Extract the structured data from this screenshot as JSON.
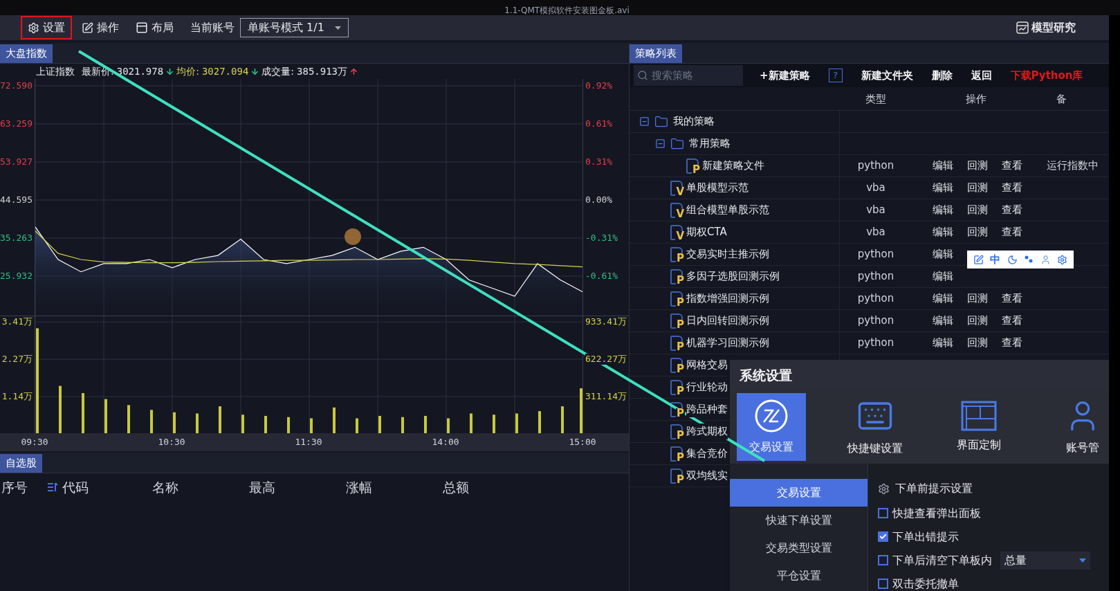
{
  "video_title": "1.1-QMT模拟软件安装图金板.avi",
  "toolbar": {
    "items": [
      {
        "kind": "gear",
        "label": "设置",
        "highlighted": true
      },
      {
        "kind": "edit",
        "label": "操作",
        "highlighted": false
      },
      {
        "kind": "layout",
        "label": "布局",
        "highlighted": false
      }
    ],
    "account_label": "当前账号",
    "account_mode": "单账号模式 1/1",
    "research_button": "模型研究"
  },
  "market_panel": {
    "tab": {
      "label": "大盘指数",
      "selected": true
    },
    "index_name": "上证指数",
    "stats": [
      {
        "kind": "price",
        "label": "最新价:",
        "value": "3021.978",
        "rising": false
      },
      {
        "kind": "average",
        "label": "均价:",
        "value": "3027.094",
        "rising": false
      },
      {
        "kind": "volume",
        "label": "成交量:",
        "value": "385.913万",
        "rising": true
      }
    ],
    "price_chart": {
      "pct_labels": [
        {
          "label": "0.92%",
          "color": "#e0404a"
        },
        {
          "label": "0.61%",
          "color": "#e0404a"
        },
        {
          "label": "0.31%",
          "color": "#e0404a"
        },
        {
          "label": "0.00%",
          "color": "#d0d0d0"
        },
        {
          "label": "-0.31%",
          "color": "#2fbf86"
        },
        {
          "label": "-0.61%",
          "color": "#2fbf86"
        }
      ],
      "chart_data": {
        "type": "line",
        "grid": true,
        "ylim": [
          16.26,
          74.29
        ],
        "categories": [
          null,
          null,
          null,
          null,
          null,
          null,
          null,
          null,
          null,
          null,
          null,
          null,
          null,
          null,
          null,
          null,
          null,
          null,
          null,
          null,
          null,
          null,
          null,
          null,
          null
        ],
        "yticks": [
          {
            "value": 72.59,
            "label": "72.590"
          },
          {
            "value": 63.259,
            "label": "63.259"
          },
          {
            "value": 53.927,
            "label": "53.927"
          },
          {
            "value": 44.595,
            "label": "44.595"
          },
          {
            "value": 35.263,
            "label": "35.263"
          },
          {
            "value": 25.932,
            "label": "25.932"
          }
        ],
        "series": [
          {
            "color": "#ffffff",
            "values": [
              38,
              30,
              27,
              29,
              29,
              30,
              28,
              30,
              31,
              35,
              30,
              29,
              30,
              31,
              33,
              30,
              32,
              33,
              30,
              25,
              23,
              21,
              29,
              25,
              22
            ]
          },
          {
            "color": "#d8d24a",
            "values": [
              37,
              31.5,
              30,
              29.4,
              29.3,
              29.2,
              29.2,
              29.3,
              29.5,
              29.6,
              29.7,
              29.8,
              29.8,
              29.9,
              30,
              30,
              30.1,
              30.2,
              30.1,
              29.8,
              29.4,
              29,
              28.8,
              28.5,
              28.2
            ]
          }
        ]
      }
    },
    "volume_chart": {
      "left_labels": [
        "3.41万",
        "2.27万",
        "1.14万"
      ],
      "chart_data": {
        "type": "bar",
        "grid": true,
        "ylim": [
          0,
          980
        ],
        "categories": [
          "09:30",
          null,
          null,
          null,
          null,
          null,
          "10:30",
          null,
          null,
          null,
          null,
          null,
          "11:30",
          null,
          null,
          null,
          null,
          null,
          "14:00",
          null,
          null,
          null,
          null,
          null,
          "15:00"
        ],
        "yticks": [
          {
            "value": 933.41,
            "label": "933.41万"
          },
          {
            "value": 622.27,
            "label": "622.27万"
          },
          {
            "value": 311.14,
            "label": "311.14万"
          }
        ],
        "series": [
          {
            "color": "#c9c93a",
            "values": [
              880,
              400,
              340,
              290,
              240,
              200,
              180,
              170,
              230,
              160,
              150,
              140,
              130,
              220,
              130,
              150,
              140,
              150,
              130,
              170,
              160,
              170,
              190,
              230,
              380
            ]
          }
        ]
      }
    }
  },
  "watchlist": {
    "tab": {
      "label": "自选股",
      "selected": true
    },
    "columns": [
      {
        "label": "序号",
        "sorted": false
      },
      {
        "label": "代码",
        "sorted": true
      },
      {
        "label": "名称",
        "sorted": false
      },
      {
        "label": "最高",
        "sorted": false
      },
      {
        "label": "涨幅",
        "sorted": false
      },
      {
        "label": "总额",
        "sorted": false
      }
    ]
  },
  "strategy_panel": {
    "tab": {
      "label": "策略列表",
      "selected": true
    },
    "search": {
      "placeholder": "搜索策略"
    },
    "actions": [
      {
        "kind": "text",
        "label": "+新建策略"
      },
      {
        "kind": "help",
        "label": "?"
      },
      {
        "kind": "text",
        "label": "新建文件夹"
      },
      {
        "kind": "text",
        "label": "删除"
      },
      {
        "kind": "text",
        "label": "返回"
      },
      {
        "kind": "link",
        "label": "下载Python库"
      }
    ],
    "columns": [
      "类型",
      "操作",
      "备"
    ],
    "tree": [
      {
        "kind": "folder",
        "name": "我的策略",
        "expanded": true,
        "children": [
          {
            "kind": "folder",
            "name": "常用策略",
            "expanded": true,
            "children": [
              {
                "kind": "file",
                "badge": "P",
                "name": "新建策略文件",
                "type": "python",
                "actions": [
                  "编辑",
                  "回测",
                  "查看"
                ],
                "note": "运行指数中"
              }
            ]
          },
          {
            "kind": "file",
            "badge": "V",
            "name": "单股模型示范",
            "type": "vba",
            "actions": [
              "编辑",
              "回测",
              "查看"
            ]
          },
          {
            "kind": "file",
            "badge": "V",
            "name": "组合模型单股示范",
            "type": "vba",
            "actions": [
              "编辑",
              "回测",
              "查看"
            ]
          },
          {
            "kind": "file",
            "badge": "V",
            "name": "期权CTA",
            "type": "vba",
            "actions": [
              "编辑",
              "回测",
              "查看"
            ]
          },
          {
            "kind": "file",
            "badge": "P",
            "name": "交易实时主推示例",
            "type": "python",
            "actions": [
              "编辑"
            ]
          },
          {
            "kind": "file",
            "badge": "P",
            "name": "多因子选股回测示例",
            "type": "python",
            "actions": [
              "编辑"
            ]
          },
          {
            "kind": "file",
            "badge": "P",
            "name": "指数增强回测示例",
            "type": "python",
            "actions": [
              "编辑",
              "回测",
              "查看"
            ]
          },
          {
            "kind": "file",
            "badge": "P",
            "name": "日内回转回测示例",
            "type": "python",
            "actions": [
              "编辑",
              "回测",
              "查看"
            ]
          },
          {
            "kind": "file",
            "badge": "P",
            "name": "机器学习回测示例",
            "type": "python",
            "actions": [
              "编辑",
              "回测",
              "查看"
            ]
          },
          {
            "kind": "file",
            "badge": "P",
            "name": "网格交易"
          },
          {
            "kind": "file",
            "badge": "P",
            "name": "行业轮动"
          },
          {
            "kind": "file",
            "badge": "P",
            "name": "跨品种套"
          },
          {
            "kind": "file",
            "badge": "P",
            "name": "跨式期权"
          },
          {
            "kind": "file",
            "badge": "P",
            "name": "集合竞价"
          },
          {
            "kind": "file",
            "badge": "P",
            "name": "双均线实"
          }
        ]
      }
    ]
  },
  "ime_toolbar": {
    "mode": "中"
  },
  "settings_dialog": {
    "title": "系统设置",
    "categories": [
      {
        "kind": "trade",
        "label": "交易设置",
        "selected": true
      },
      {
        "kind": "keyboard",
        "label": "快捷键设置",
        "selected": false
      },
      {
        "kind": "layout",
        "label": "界面定制",
        "selected": false
      },
      {
        "kind": "user",
        "label": "账号管",
        "selected": false
      }
    ],
    "menu": [
      {
        "label": "交易设置",
        "selected": true
      },
      {
        "label": "快速下单设置",
        "selected": false
      },
      {
        "label": "交易类型设置",
        "selected": false
      },
      {
        "label": "平仓设置",
        "selected": false
      }
    ],
    "section_title": "下单前提示设置",
    "options": [
      {
        "label": "快捷查看弹出面板",
        "checked": false
      },
      {
        "label": "下单出错提示",
        "checked": true
      },
      {
        "label": "下单后清空下单板内",
        "checked": false,
        "select": "总量"
      },
      {
        "label": "双击委托撤单",
        "checked": false
      }
    ]
  }
}
